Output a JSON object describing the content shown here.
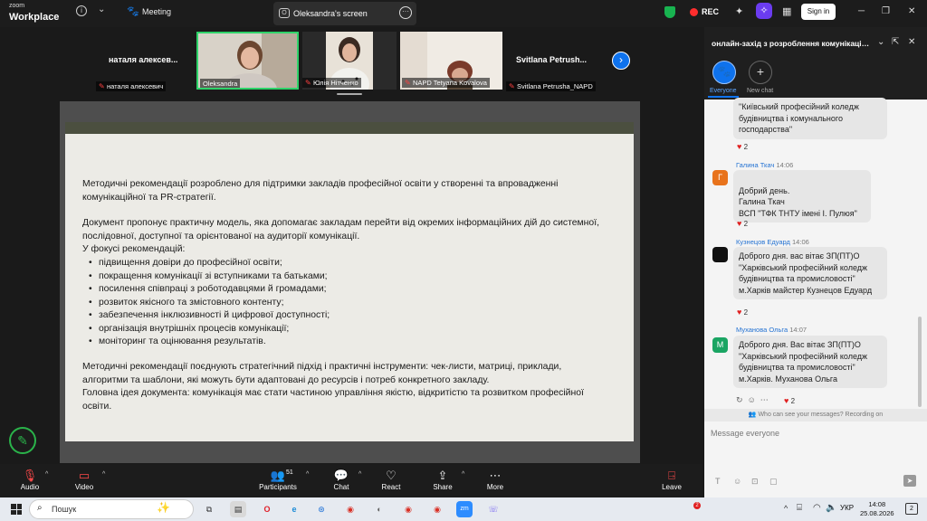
{
  "topbar": {
    "brand_small": "zoom",
    "brand_big": "Workplace",
    "meeting_label": "Meeting",
    "screen_tab_label": "Oleksandra's screen",
    "rec_label": "REC",
    "signin_label": "Sign in"
  },
  "participants": {
    "big_names": [
      "наталя алексев...",
      "Svitlana  Petrush..."
    ],
    "tiles": [
      {
        "label": "наталя алексевич"
      },
      {
        "label": "Oleksandra"
      },
      {
        "label": "Юлія Нітченко"
      },
      {
        "label": "NAPD Tetyana Kovalova"
      },
      {
        "label": "Svitlana Petrusha_NAPD"
      }
    ]
  },
  "slide": {
    "p1": "Методичні рекомендації розроблено для підтримки закладів професійної освіти у створенні та впровадженні комунікаційної та PR-стратегії.",
    "p2": "Документ пропонує практичну модель, яка допомагає закладам перейти від окремих інформаційних дій до системної, послідовної, доступної та орієнтованої на аудиторії комунікації.",
    "p3": "У фокусі рекомендацій:",
    "bullets": [
      "підвищення довіри до професійної освіти;",
      "покращення комунікації зі вступниками та батьками;",
      "посилення співпраці з роботодавцями й громадами;",
      "розвиток якісного та змістовного контенту;",
      "забезпечення інклюзивності й цифрової доступності;",
      "організація внутрішніх процесів комунікації;",
      "моніторинг та оцінювання результатів."
    ],
    "p4": "Методичні рекомендації поєднують стратегічний підхід і практичні інструменти: чек-листи, матриці, приклади, алгоритми та шаблони, які можуть бути адаптовані до ресурсів і потреб конкретного закладу.",
    "p5": "Головна ідея документа: комунікація має стати частиною управління якістю, відкритістю та розвитком професійної освіти."
  },
  "toolbar": {
    "audio": "Audio",
    "video": "Video",
    "participants": "Participants",
    "participants_count": "51",
    "chat": "Chat",
    "react": "React",
    "share": "Share",
    "more": "More",
    "leave": "Leave"
  },
  "chat": {
    "title": "онлайн-захід з розроблення комунікаційн...",
    "everyone_label": "Everyone",
    "newchat_label": "New chat",
    "messages": [
      {
        "text": "\"Київський професійний коледж будівництва і комунального господарства\"",
        "reaction": "2"
      },
      {
        "sender": "Галина Ткач",
        "time": "14:06",
        "avatar_letter": "Г",
        "avatar_color": "#e8731c",
        "text": "Добрий день.\nГалина Ткач\nВСП \"ТФК ТНТУ імені І. Пулюя\"",
        "reaction": "2"
      },
      {
        "sender": "Кузнецов Едуард",
        "time": "14:06",
        "avatar_letter": "",
        "avatar_color": "#111111",
        "text": "Доброго дня. вас вітає ЗП(ПТ)О \"Харківський професійний коледж будівництва та промисловості\" м.Харків майстер Кузнецов Едуард",
        "reaction": "2"
      },
      {
        "sender": "Муханова Ольга",
        "time": "14:07",
        "avatar_letter": "М",
        "avatar_color": "#1aa563",
        "text": "Доброго дня. Вас вітає ЗП(ПТ)О \"Харківський професійний коледж будівництва та промисловості\" м.Харків. Муханова Ольга",
        "reaction": "2"
      }
    ],
    "privacy_note": "Who can see your messages? Recording on",
    "input_placeholder": "Message everyone"
  },
  "taskbar": {
    "search_label": "Пошук",
    "notification_badge": "2",
    "lang": "УКР",
    "time": "14:08",
    "date": "25.08.2026",
    "notif_count": "2"
  }
}
